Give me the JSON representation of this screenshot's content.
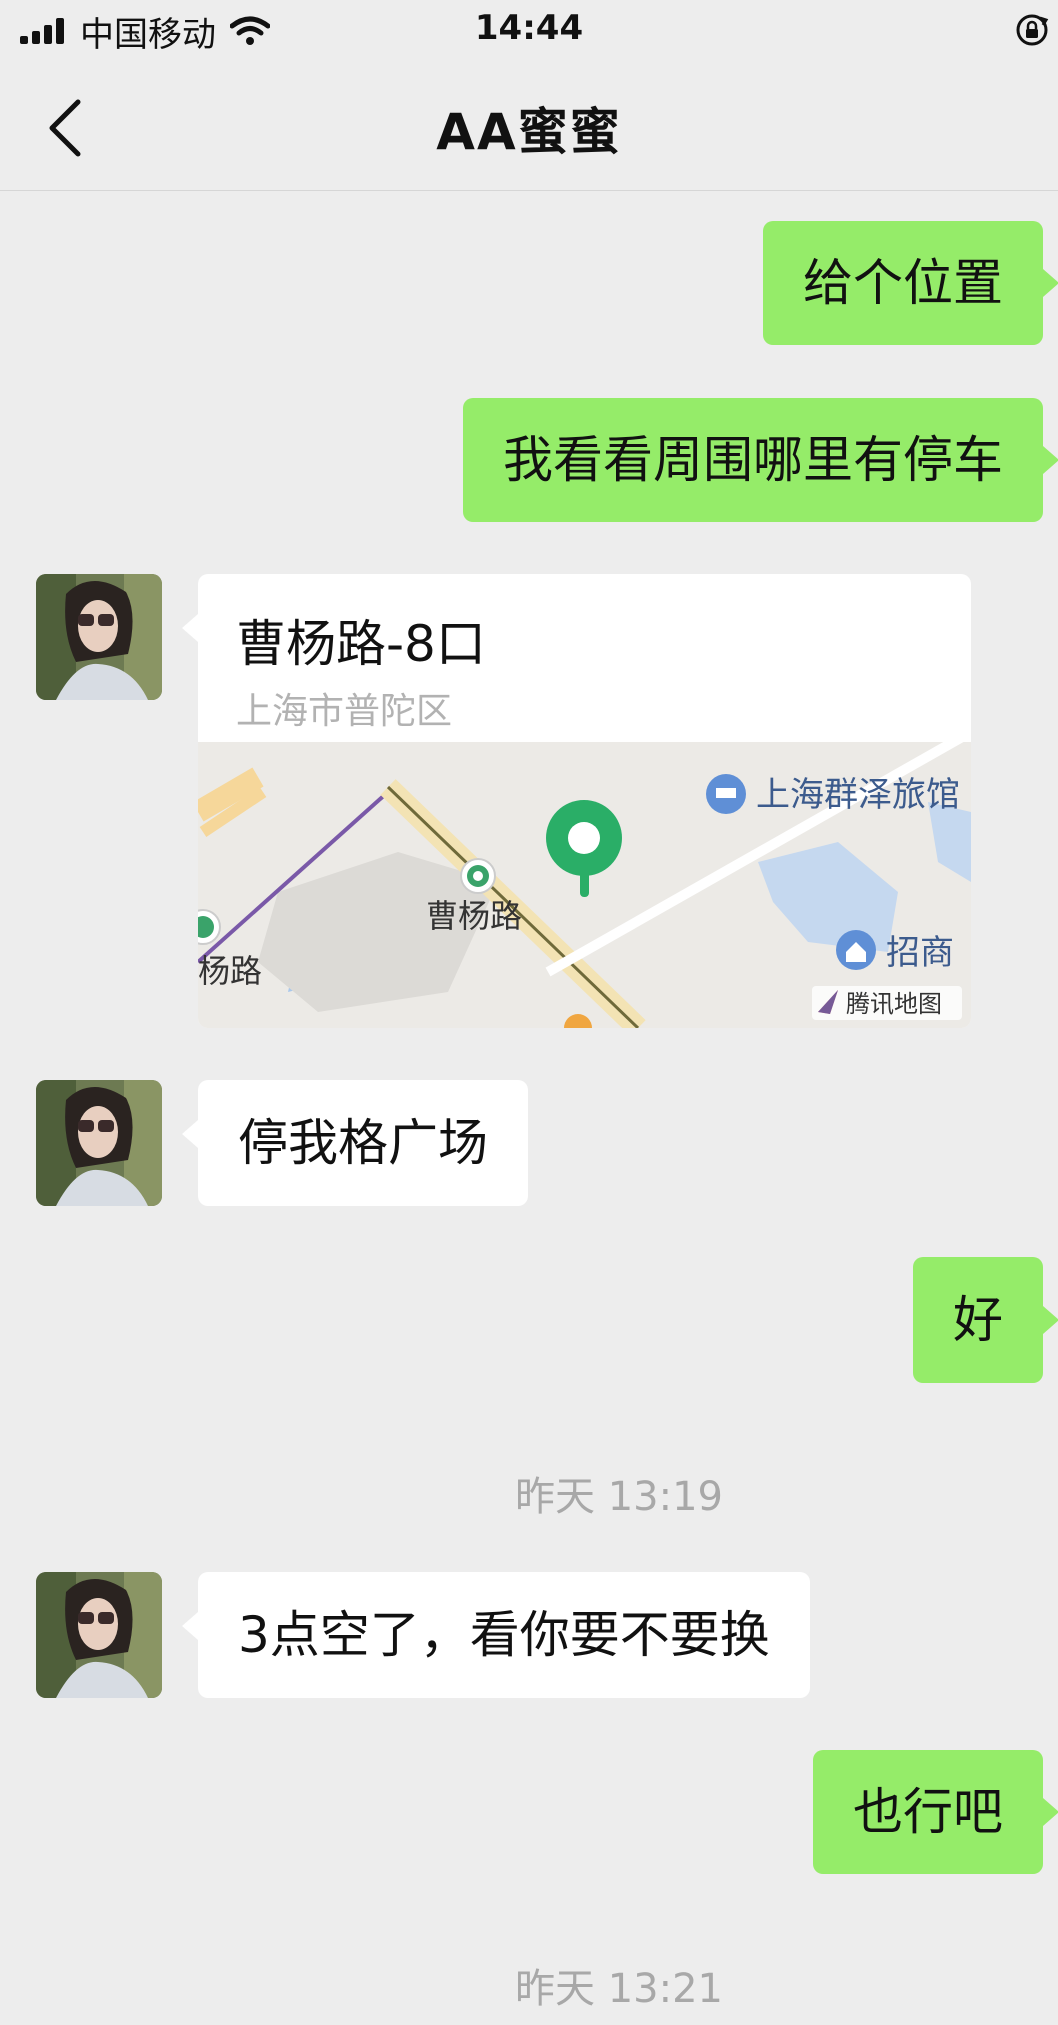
{
  "status_bar": {
    "carrier": "中国移动",
    "time": "14:44"
  },
  "nav": {
    "title": "AA蜜蜜"
  },
  "messages": [
    {
      "dir": "out",
      "text": "给个位置"
    },
    {
      "dir": "out",
      "text": "我看看周围哪里有停车"
    },
    {
      "dir": "in",
      "type": "location",
      "name": "曹杨路-8口",
      "address": "上海市普陀区"
    },
    {
      "dir": "in",
      "text": "停我格广场"
    },
    {
      "dir": "out",
      "text": "好"
    },
    {
      "type": "time",
      "text": "昨天 13:19"
    },
    {
      "dir": "in",
      "text": "3点空了，看你要不要换"
    },
    {
      "dir": "out",
      "text": "也行吧"
    },
    {
      "type": "time",
      "text": "昨天 13:21"
    }
  ],
  "map": {
    "labels": {
      "hotel": "上海群泽旅馆",
      "station": "曹杨路",
      "left_road": "杨路",
      "bank": "招商",
      "provider": "腾讯地图"
    },
    "pin_color": "#2aae67"
  },
  "colors": {
    "outgoing_bubble": "#95ec69",
    "incoming_bubble": "#ffffff",
    "background": "#ededed"
  }
}
